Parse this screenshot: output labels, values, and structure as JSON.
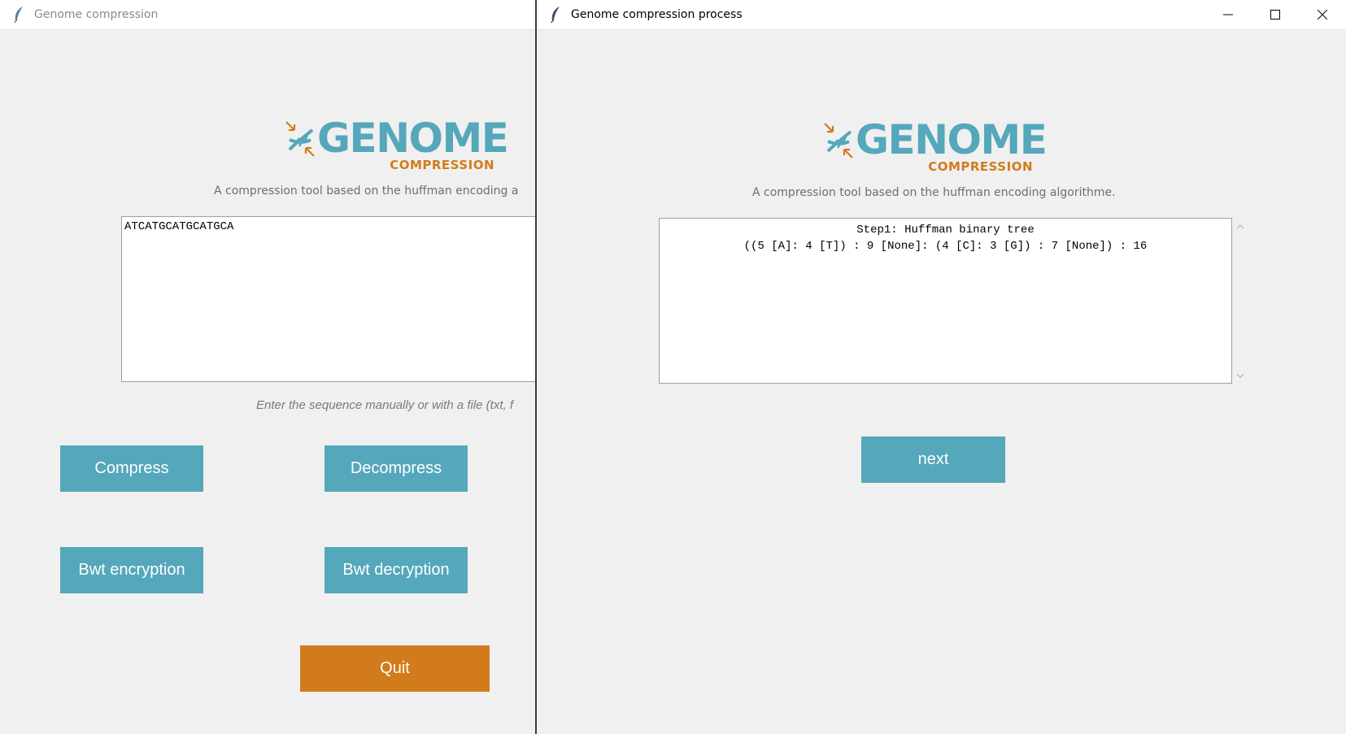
{
  "main_window": {
    "title": "Genome compression",
    "logo": {
      "word": "GENOME",
      "sub": "COMPRESSION"
    },
    "tagline": "A compression tool based on the huffman encoding a",
    "sequence_input": {
      "value": "ATCATGCATGCATGCA"
    },
    "hint": "Enter the sequence manually or with a file (txt, f",
    "buttons": {
      "compress": "Compress",
      "decompress": "Decompress",
      "bwt_encryption": "Bwt encryption",
      "bwt_decryption": "Bwt decryption",
      "quit": "Quit"
    }
  },
  "process_window": {
    "title": "Genome compression process",
    "logo": {
      "word": "GENOME",
      "sub": "COMPRESSION"
    },
    "tagline": "A compression tool based on the huffman encoding algorithme.",
    "output_lines": {
      "line1": "Step1: Huffman binary tree",
      "line2": "((5 [A]: 4 [T]) : 9 [None]: (4 [C]: 3 [G]) : 7 [None]) : 16"
    },
    "next_label": "next"
  },
  "icons": {
    "app": "feather-icon",
    "logo": "dna-compress-icon",
    "minimize": "minimize-icon",
    "maximize": "maximize-icon",
    "close": "close-icon",
    "scroll_up": "chevron-up-icon",
    "scroll_down": "chevron-down-icon"
  },
  "colors": {
    "accent": "#55a7bb",
    "quit": "#d27b1c",
    "background": "#f0f0f0"
  }
}
